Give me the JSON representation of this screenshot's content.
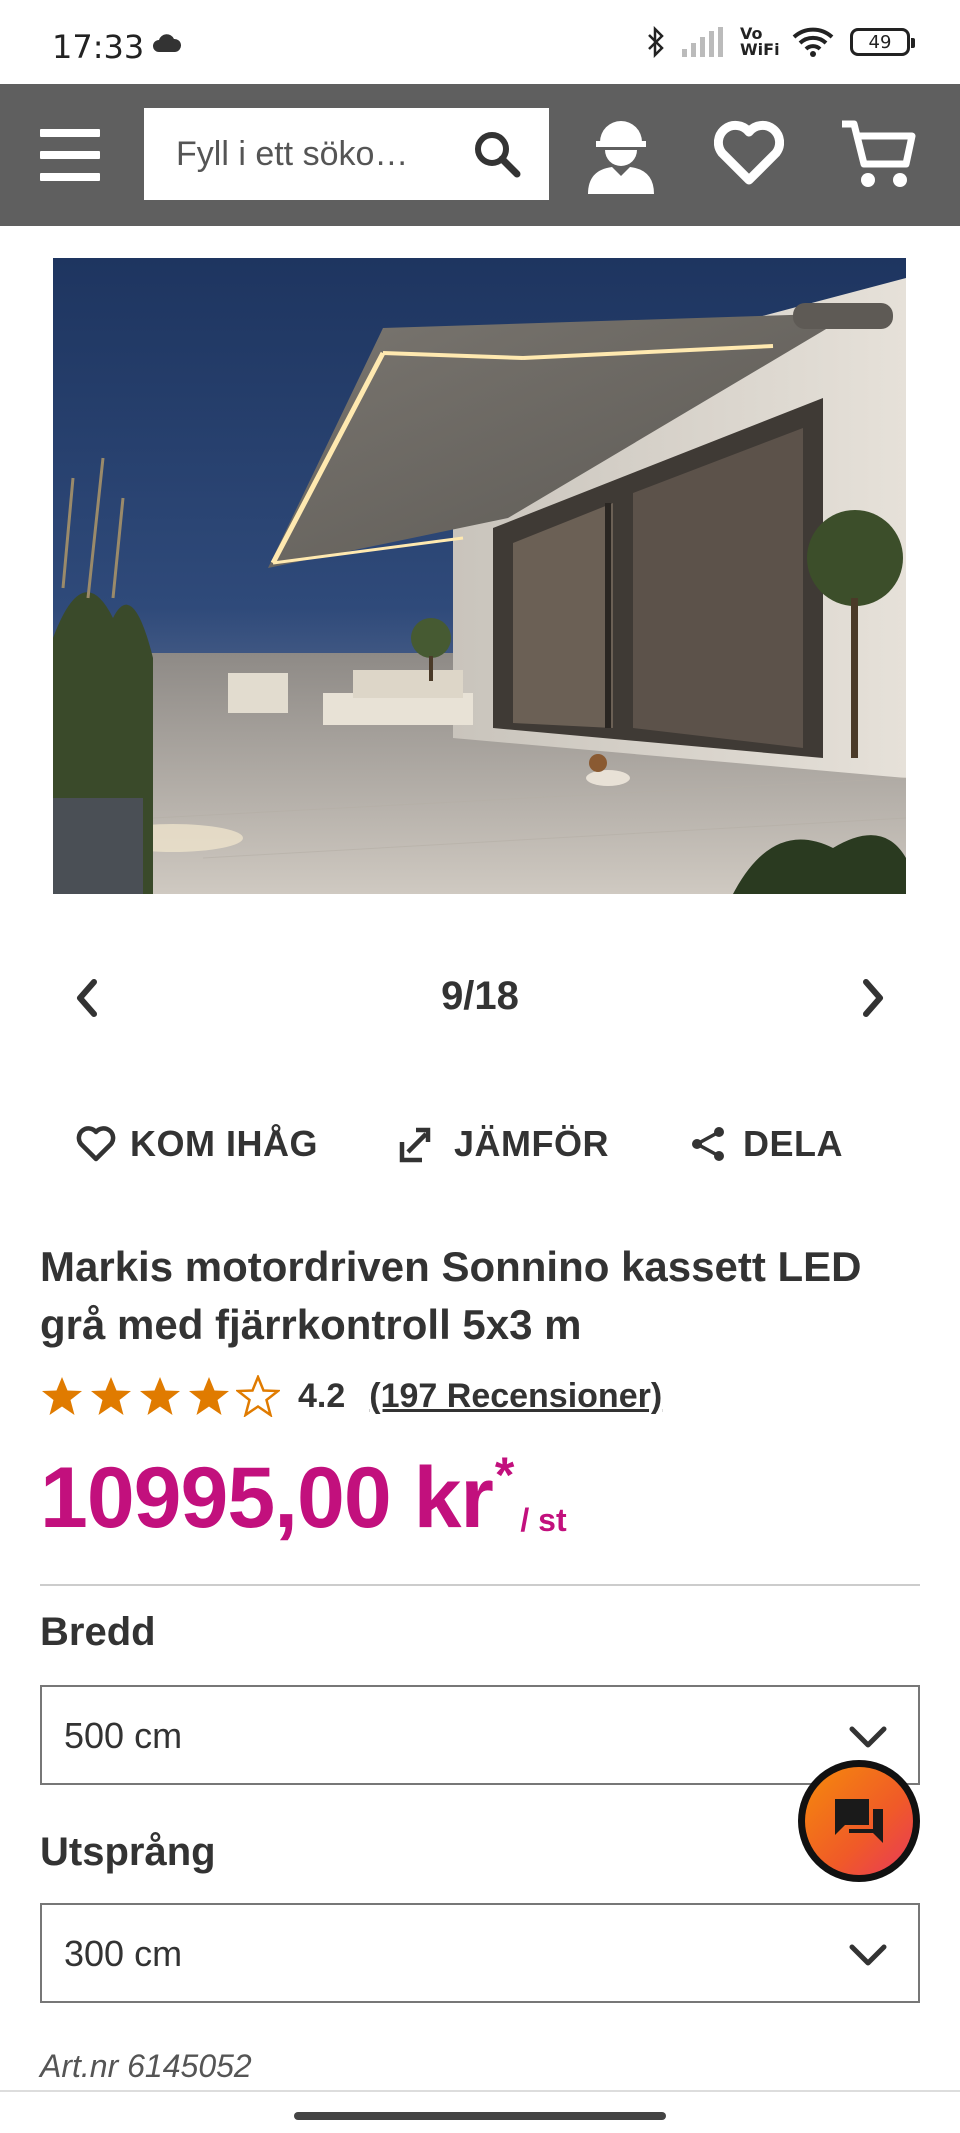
{
  "status_bar": {
    "time": "17:33",
    "network_label": "Vo WiFi",
    "battery": "49"
  },
  "header": {
    "search_placeholder": "Fyll i ett söko…",
    "icons": [
      "menu-icon",
      "search-icon",
      "contractor-account-icon",
      "heart-icon",
      "cart-icon"
    ]
  },
  "gallery": {
    "counter": "9/18"
  },
  "actions": {
    "remember": "KOM IHÅG",
    "compare": "JÄMFÖR",
    "share": "DELA"
  },
  "product": {
    "title": "Markis motordriven Sonnino kassett LED grå med fjärrkontroll 5x3 m",
    "rating_value": "4.2",
    "rating_fraction": 0.84,
    "reviews": "(197 Recensioner)",
    "price": "10995,00 kr",
    "price_mark": "*",
    "price_unit": "/ st",
    "art_nr": "Art.nr 6145052"
  },
  "options": {
    "width_label": "Bredd",
    "width_value": "500 cm",
    "projection_label": "Utsprång",
    "projection_value": "300 cm"
  },
  "colors": {
    "header_bg": "#5f5f5f",
    "price": "#c2107d",
    "star": "#e07b00",
    "chat_gradient_start": "#f58a0b",
    "chat_gradient_end": "#e8395a"
  }
}
